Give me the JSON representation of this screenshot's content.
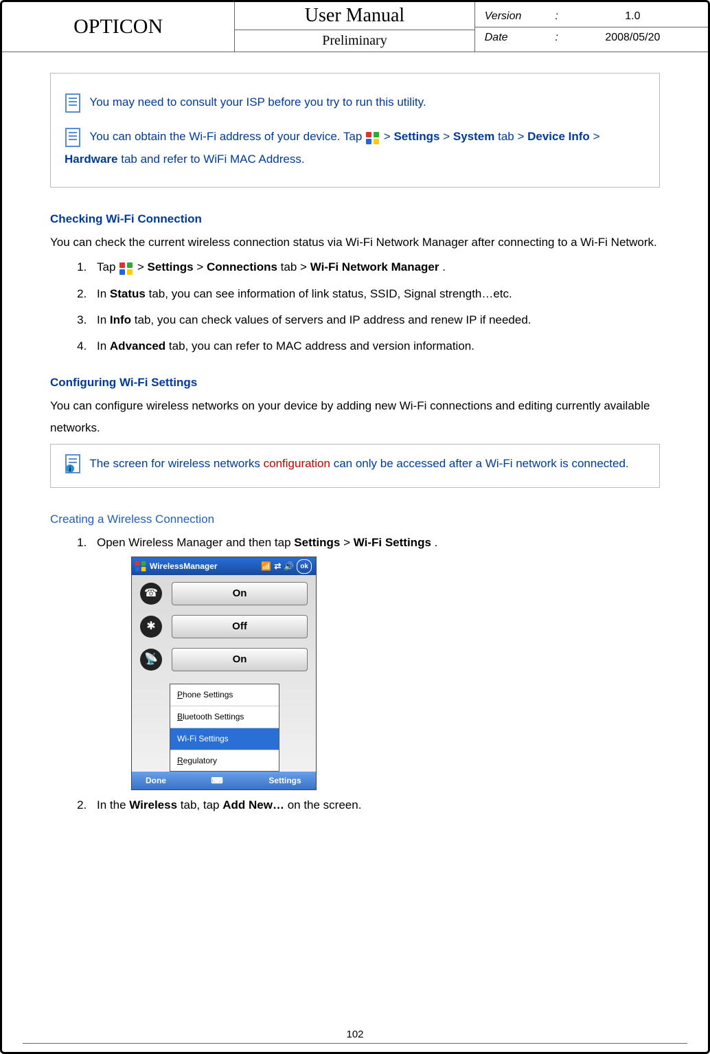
{
  "header": {
    "brand": "OPTICON",
    "title": "User Manual",
    "subtitle": "Preliminary",
    "meta": {
      "version_label": "Version",
      "version_value": "1.0",
      "date_label": "Date",
      "date_value": "2008/05/20",
      "colon": ":"
    }
  },
  "notebox1": {
    "line1": "You may need to consult your ISP before you try to run this utility.",
    "line2_a": "You can obtain the Wi-Fi address of your device. Tap ",
    "line2_b": " > ",
    "line2_settings": "Settings",
    "line2_c": " > ",
    "line2_system": "System",
    "line2_d": " tab > ",
    "line2_device": "Device Info",
    "line2_e": " > ",
    "line2_hardware": "Hardware",
    "line2_f": " tab and refer to WiFi MAC Address."
  },
  "section1": {
    "heading": "Checking Wi-Fi Connection",
    "intro": "You can check the current wireless connection status via Wi-Fi Network Manager after connecting to a Wi-Fi Network.",
    "steps": {
      "s1_a": "Tap ",
      "s1_b": " > ",
      "s1_settings": "Settings",
      "s1_c": " > ",
      "s1_connections": "Connections",
      "s1_d": " tab > ",
      "s1_mgr": "Wi-Fi Network Manager",
      "s1_e": ".",
      "s2_a": "In ",
      "s2_status": "Status",
      "s2_b": " tab, you can see information of link status, SSID, Signal strength…etc.",
      "s3_a": "In ",
      "s3_info": "Info",
      "s3_b": " tab, you can check values of servers and IP address and renew IP if needed.",
      "s4_a": "In ",
      "s4_adv": "Advanced",
      "s4_b": " tab, you can refer to MAC address and version information."
    }
  },
  "section2": {
    "heading": "Configuring Wi-Fi Settings",
    "intro": "You can configure wireless networks on your device by adding new Wi-Fi connections and editing currently available networks."
  },
  "notebox2": {
    "a": "The screen for wireless networks ",
    "config": "configuration",
    "b": " can only be accessed after a Wi-Fi network is connected."
  },
  "section3": {
    "heading": "Creating a Wireless Connection",
    "s1_a": "Open Wireless Manager and then tap ",
    "s1_settings": "Settings",
    "s1_b": " > ",
    "s1_wifi": "Wi-Fi Settings",
    "s1_c": ".",
    "s2_a": "In the ",
    "s2_wireless": "Wireless",
    "s2_b": " tab, tap ",
    "s2_addnew": "Add New…",
    "s2_c": " on the screen."
  },
  "screenshot": {
    "title": "WirelessManager",
    "ok": "ok",
    "rows": {
      "phone": "On",
      "bt": "Off",
      "wifi": "On"
    },
    "menu": {
      "m1": "Phone Settings",
      "m2": "Bluetooth Settings",
      "m3": "Wi-Fi Settings",
      "m4": "Regulatory"
    },
    "bottom": {
      "done": "Done",
      "kbd": "⌨",
      "settings": "Settings"
    }
  },
  "page_number": "102"
}
